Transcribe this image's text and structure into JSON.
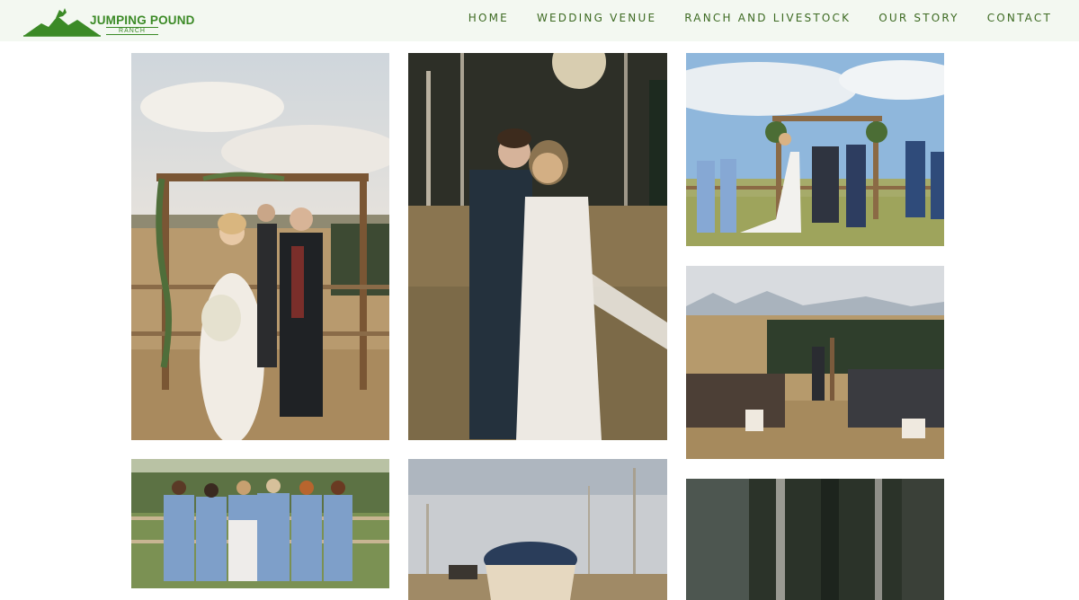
{
  "logo": {
    "name": "JUMPING POUND",
    "sub": "RANCH"
  },
  "nav": {
    "items": [
      "HOME",
      "WEDDING VENUE",
      "RANCH AND LIVESTOCK",
      "OUR STORY",
      "CONTACT"
    ]
  },
  "colors": {
    "header_bg": "#f3f8f1",
    "brand_green": "#3b8a26",
    "nav_text": "#3d6a22"
  },
  "gallery": {
    "photos": [
      "couple-under-arch",
      "couple-portrait-sunset",
      "ceremony-arch-wide",
      "ceremony-guests-seated",
      "bridesmaids-back-view",
      "basket-blankets",
      "dark-forest"
    ]
  }
}
